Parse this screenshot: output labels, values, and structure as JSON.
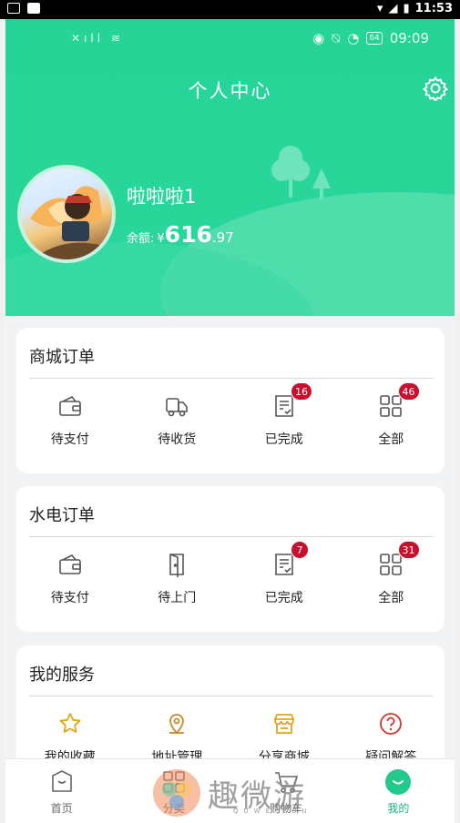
{
  "system_bar": {
    "time": "11:53"
  },
  "app_status_bar": {
    "time": "09:09",
    "battery": "64"
  },
  "header": {
    "title": "个人中心"
  },
  "profile": {
    "name": "啦啦啦1",
    "balance_label": "余额:",
    "currency": "¥",
    "balance_int": "616",
    "balance_dec": ".97"
  },
  "shop_orders": {
    "title": "商城订单",
    "items": [
      {
        "label": "待支付",
        "icon": "wallet-icon"
      },
      {
        "label": "待收货",
        "icon": "truck-icon"
      },
      {
        "label": "已完成",
        "icon": "receipt-check-icon",
        "badge": "16"
      },
      {
        "label": "全部",
        "icon": "grid-icon",
        "badge": "46"
      }
    ]
  },
  "utility_orders": {
    "title": "水电订单",
    "items": [
      {
        "label": "待支付",
        "icon": "wallet-icon"
      },
      {
        "label": "待上门",
        "icon": "door-icon"
      },
      {
        "label": "已完成",
        "icon": "receipt-check-icon",
        "badge": "7"
      },
      {
        "label": "全部",
        "icon": "grid-icon",
        "badge": "31"
      }
    ]
  },
  "services": {
    "title": "我的服务",
    "items": [
      {
        "label": "我的收藏",
        "icon": "star-icon"
      },
      {
        "label": "地址管理",
        "icon": "location-pin-icon"
      },
      {
        "label": "分享商城",
        "icon": "store-icon"
      },
      {
        "label": "疑问解答",
        "icon": "question-icon"
      }
    ]
  },
  "bottom_nav": {
    "tabs": [
      {
        "label": "首页",
        "icon": "home-bag-icon"
      },
      {
        "label": "分类",
        "icon": "category-icon"
      },
      {
        "label": "购物车",
        "icon": "cart-icon"
      },
      {
        "label": "我的",
        "icon": "profile-smile-icon",
        "active": true
      }
    ]
  },
  "watermark": {
    "text": "趣微游",
    "sub": "QUWEIYOU"
  },
  "colors": {
    "brand_green": "#2ad79c",
    "badge_red": "#c8102e",
    "active_tab": "#19b47a"
  }
}
